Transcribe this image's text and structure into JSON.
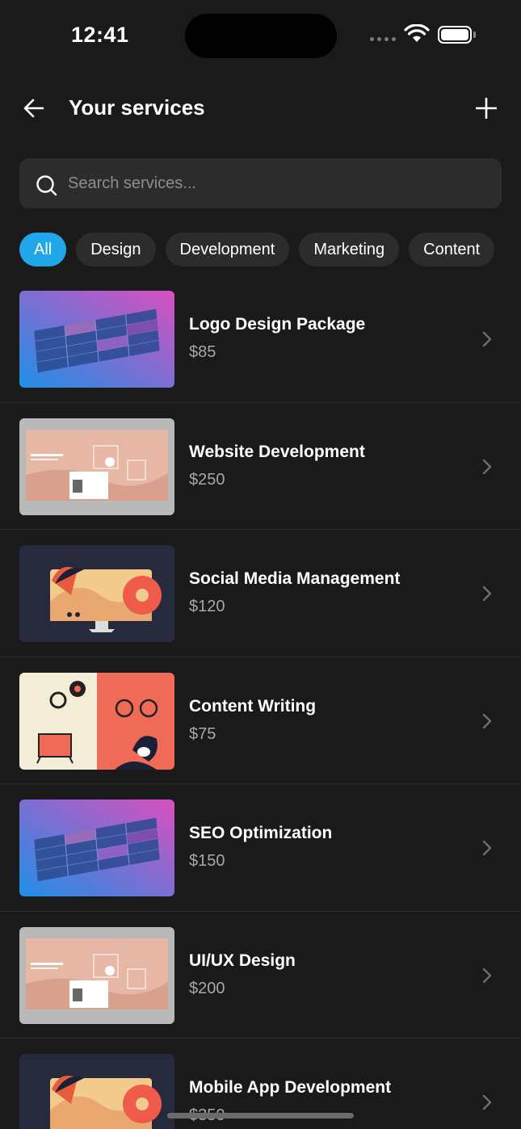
{
  "status_bar": {
    "time": "12:41"
  },
  "header": {
    "title": "Your services",
    "back_icon": "arrow-left-icon",
    "add_icon": "plus-icon"
  },
  "search": {
    "placeholder": "Search services...",
    "value": ""
  },
  "filters": [
    {
      "label": "All",
      "active": true
    },
    {
      "label": "Design",
      "active": false
    },
    {
      "label": "Development",
      "active": false
    },
    {
      "label": "Marketing",
      "active": false
    },
    {
      "label": "Content",
      "active": false
    }
  ],
  "services": [
    {
      "title": "Logo Design Package",
      "price": "$85",
      "thumb": "isometric-grid"
    },
    {
      "title": "Website Development",
      "price": "$250",
      "thumb": "portfolio-mockup"
    },
    {
      "title": "Social Media Management",
      "price": "$120",
      "thumb": "monitor-illustration"
    },
    {
      "title": "Content Writing",
      "price": "$75",
      "thumb": "split-illustration"
    },
    {
      "title": "SEO Optimization",
      "price": "$150",
      "thumb": "isometric-grid"
    },
    {
      "title": "UI/UX Design",
      "price": "$200",
      "thumb": "portfolio-mockup"
    },
    {
      "title": "Mobile App Development",
      "price": "$350",
      "thumb": "monitor-illustration"
    }
  ],
  "colors": {
    "background": "#1a1a1a",
    "accent": "#1fa7e9",
    "surface": "#2c2c2c"
  }
}
